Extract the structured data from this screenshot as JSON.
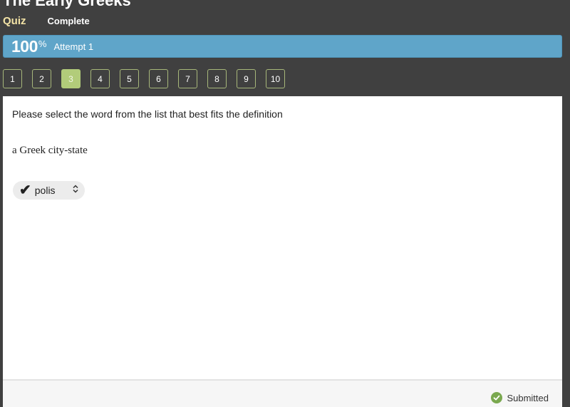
{
  "header": {
    "title": "The Early Greeks",
    "section": "Quiz",
    "status": "Complete"
  },
  "score": {
    "percent": "100",
    "percent_sign": "%",
    "attempt": "Attempt 1",
    "bar_color": "#5fa5c9"
  },
  "question_nav": {
    "active_index": 3,
    "active_color": "#b2cc7a",
    "items": [
      "1",
      "2",
      "3",
      "4",
      "5",
      "6",
      "7",
      "8",
      "9",
      "10"
    ]
  },
  "question": {
    "prompt": "Please select the word from the list that best fits the definition",
    "definition": "a Greek city-state",
    "answer": {
      "selected": "polis",
      "status_icon": "check-icon",
      "control_icon": "up-down-chevron-icon"
    }
  },
  "footer": {
    "status": "Submitted",
    "status_icon": "check-circle-icon",
    "status_color": "#7aa84f"
  }
}
